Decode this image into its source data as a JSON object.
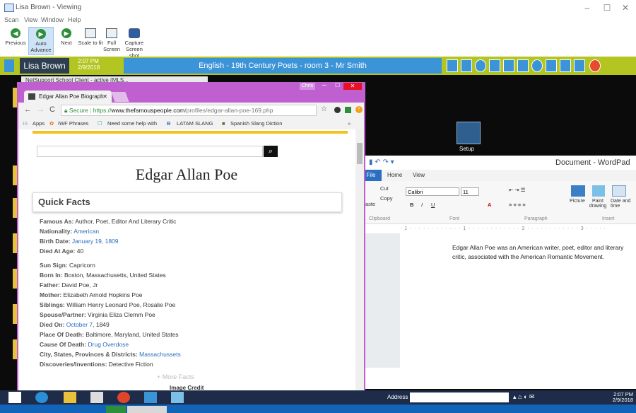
{
  "viewer": {
    "title": "Lisa Brown - Viewing",
    "menu": [
      "Scan",
      "View",
      "Window",
      "Help"
    ],
    "toolbar": {
      "previous": "Previous",
      "auto_advance": "Auto Advance",
      "next": "Next",
      "scale_to_fit": "Scale to fit",
      "full_screen": "Full Screen",
      "capture_screenshot": "Capture Screen shot"
    }
  },
  "session": {
    "user": "Lisa Brown",
    "time": "2:07 PM",
    "date": "2/9/2018",
    "class_title": "English - 19th Century Poets - room 3 - Mr Smith",
    "bar_color": "#b3c520"
  },
  "desktop": {
    "netsupport_strip": "NetSupport School Client - active (MLS...",
    "setup_label": "Setup"
  },
  "wordpad": {
    "title": "Document - WordPad",
    "tabs": [
      "File",
      "Home",
      "View"
    ],
    "clipboard": {
      "cut": "Cut",
      "copy": "Copy",
      "paste": "Paste",
      "group": "Clipboard"
    },
    "font": {
      "name": "Calibri",
      "size": "11",
      "group": "Font"
    },
    "paragraph_group": "Paragraph",
    "insert": {
      "picture": "Picture",
      "paint": "Paint drawing",
      "date": "Date and time",
      "group": "Insert"
    },
    "document_text": "Edgar Allan Poe was an American writer, poet, editor and literary critic, associated with the American Romantic Movement."
  },
  "chrome": {
    "window_user": "Chris",
    "tab_title": "Edgar Allan Poe Biograph",
    "url_secure": "Secure",
    "url_https": "https://",
    "url_host": "www.thefamouspeople.com",
    "url_path": "/profiles/edgar-allan-poe-169.php",
    "bookmarks": [
      "Apps",
      "IWF Phrases",
      "Need some help with",
      "LATAM SLANG",
      "Spanish Slang Diction"
    ],
    "frame_color": "#c060d0"
  },
  "page": {
    "title": "Edgar Allan Poe",
    "quick_facts": "Quick Facts",
    "facts": [
      {
        "label": "Famous As:",
        "value": "Author, Poet, Editor And Literary Critic",
        "link": ""
      },
      {
        "label": "Nationality:",
        "value": "",
        "link": "American"
      },
      {
        "label": "Birth Date:",
        "value": "",
        "link": "January 19, 1809"
      },
      {
        "label": "Died At Age:",
        "value": "40",
        "link": ""
      },
      {
        "label": "Sun Sign:",
        "value": "Capricorn",
        "link": ""
      },
      {
        "label": "Born In:",
        "value": "Boston, Massachusetts, United States",
        "link": ""
      },
      {
        "label": "Father:",
        "value": "David Poe, Jr",
        "link": ""
      },
      {
        "label": "Mother:",
        "value": "Elizabeth Arnold Hopkins Poe",
        "link": ""
      },
      {
        "label": "Siblings:",
        "value": "William Henry Leonard Poe, Rosalie Poe",
        "link": ""
      },
      {
        "label": "Spouse/Partner:",
        "value": "Virginia Eliza Clemm Poe",
        "link": ""
      },
      {
        "label": "Died On:",
        "value": ", 1849",
        "link": "October 7"
      },
      {
        "label": "Place Of Death:",
        "value": "Baltimore, Maryland, United States",
        "link": ""
      },
      {
        "label": "Cause Of Death:",
        "value": "",
        "link": "Drug Overdose"
      },
      {
        "label": "City, States, Provinces & Districts:",
        "value": "",
        "link": "Massachussets"
      },
      {
        "label": "Discoveries/Inventions:",
        "value": "Detective Fiction",
        "link": ""
      }
    ],
    "more_facts": "More Facts",
    "image_credit": "Image Credit"
  },
  "taskbar": {
    "address": "Address",
    "clock_time": "2:07 PM",
    "clock_date": "2/9/2018"
  }
}
